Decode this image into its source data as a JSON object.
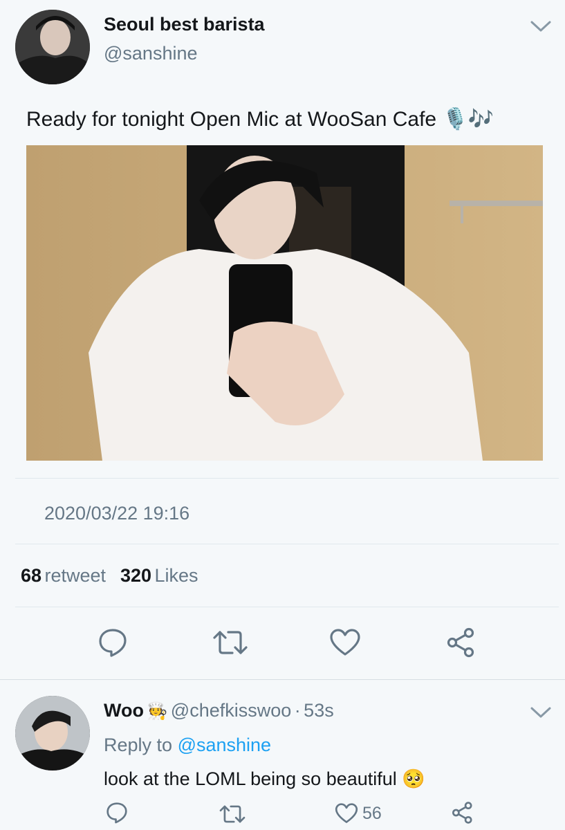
{
  "tweet": {
    "author_name": "Seoul best barista",
    "author_handle": "@sanshine",
    "text": "Ready for tonight Open Mic at WooSan Cafe",
    "text_emoji": "🎙️🎶",
    "timestamp": "2020/03/22 19:16",
    "retweet_count": "68",
    "retweet_label": "retweet",
    "like_count": "320",
    "like_label": "Likes"
  },
  "reply": {
    "author_name": "Woo",
    "author_badge": "🧑‍🍳",
    "author_handle": "@chefkisswoo",
    "separator": "·",
    "age": "53s",
    "reply_prefix": "Reply to",
    "reply_target": "@sanshine",
    "text": "look at the LOML being so beautiful",
    "text_emoji": "🥺",
    "like_count": "56"
  },
  "icons": {
    "menu": "chevron-down-icon",
    "reply": "speech-bubble-icon",
    "retweet": "retweet-icon",
    "like": "heart-icon",
    "share": "share-icon"
  },
  "colors": {
    "background": "#f5f8fa",
    "text": "#14171a",
    "secondary": "#657786",
    "link": "#1da1f2",
    "icon": "#657786"
  }
}
